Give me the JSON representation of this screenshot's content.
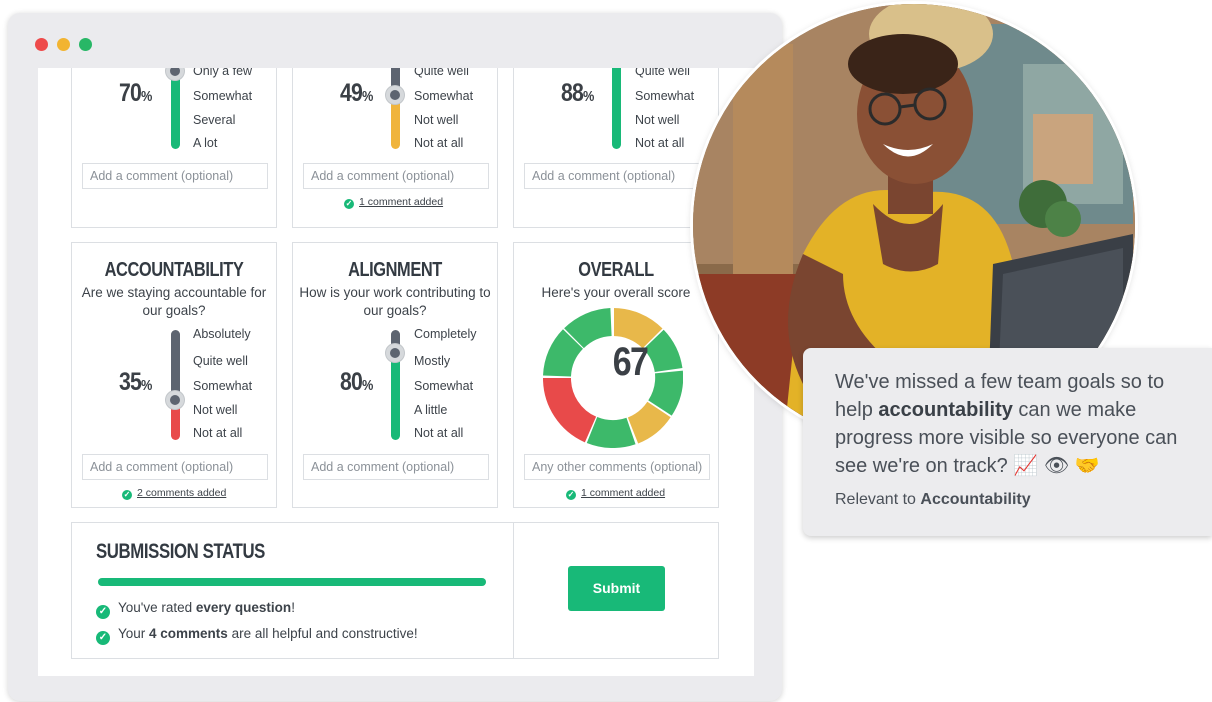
{
  "colors": {
    "accent": "#18b978",
    "warning": "#f0b43c",
    "danger": "#e84a4a",
    "neutral": "#5d6470"
  },
  "top_cards": [
    {
      "pct": "70",
      "options": [
        "Only a few",
        "Somewhat",
        "Several",
        "A lot"
      ],
      "comment_placeholder": "Add a comment (optional)",
      "comments_added": ""
    },
    {
      "pct": "49",
      "options": [
        "Quite well",
        "Somewhat",
        "Not well",
        "Not at all"
      ],
      "comment_placeholder": "Add a comment (optional)",
      "comments_added": "1 comment added"
    },
    {
      "pct": "88",
      "options": [
        "Quite well",
        "Somewhat",
        "Not well",
        "Not at all"
      ],
      "comment_placeholder": "Add a comment (optional)",
      "comments_added": ""
    }
  ],
  "cards": {
    "accountability": {
      "title": "ACCOUNTABILITY",
      "question": "Are we staying accountable for our goals?",
      "pct": "35",
      "options": [
        "Absolutely",
        "Quite well",
        "Somewhat",
        "Not well",
        "Not at all"
      ],
      "comment_placeholder": "Add a comment (optional)",
      "comments_added": "2 comments added"
    },
    "alignment": {
      "title": "ALIGNMENT",
      "question": "How is your work contributing to our goals?",
      "pct": "80",
      "options": [
        "Completely",
        "Mostly",
        "Somewhat",
        "A little",
        "Not at all"
      ],
      "comment_placeholder": "Add a comment (optional)",
      "comments_added": ""
    },
    "overall": {
      "title": "OVERALL",
      "subtitle": "Here's your overall score",
      "score": "67",
      "comment_placeholder": "Any other comments (optional)",
      "comments_added": "1 comment added"
    }
  },
  "percent_symbol": "%",
  "submission": {
    "title": "SUBMISSION STATUS",
    "progress": 1.0,
    "line1_pre": "You've rated ",
    "line1_bold": "every question",
    "line1_post": "!",
    "line2_pre": "Your ",
    "line2_bold": "4 comments",
    "line2_post": " are all helpful and constructive!",
    "submit_label": "Submit"
  },
  "bubble": {
    "text_pre": "We've missed a few team goals so to help ",
    "text_bold": "accountability",
    "text_post": " can we make progress more visible so everyone can see we're on track?",
    "emojis": "📈 👁 🤝",
    "relevant_pre": "Relevant to ",
    "relevant_bold": "Accountability"
  }
}
